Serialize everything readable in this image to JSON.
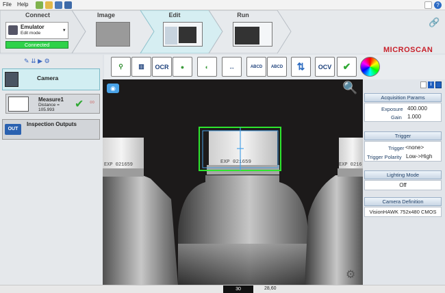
{
  "menubar": {
    "file": "File",
    "help": "Help"
  },
  "workflow": {
    "connect": {
      "label": "Connect",
      "device_name": "Emulator",
      "device_mode": "Edit mode",
      "status": "Connected"
    },
    "image": {
      "label": "Image"
    },
    "edit": {
      "label": "Edit"
    },
    "run": {
      "label": "Run"
    }
  },
  "brand": {
    "name": "MICROSCAN"
  },
  "toolbar": {
    "tools": [
      {
        "name": "locate-tool",
        "label": "⚲"
      },
      {
        "name": "barcode-tool",
        "label": "▥"
      },
      {
        "name": "ocr-tool",
        "label": "OCR"
      },
      {
        "name": "blob-tool",
        "label": "●"
      },
      {
        "name": "presence-tool",
        "label": "◐"
      },
      {
        "name": "measure-tool",
        "label": "↔"
      },
      {
        "name": "math-tool",
        "label": "ABCD"
      },
      {
        "name": "string-tool",
        "label": "ABCD"
      },
      {
        "name": "logic-tool",
        "label": "⇅"
      },
      {
        "name": "ocv-tool",
        "label": "OCV"
      },
      {
        "name": "verify-tool",
        "label": "✔"
      },
      {
        "name": "color-tool",
        "label": ""
      }
    ]
  },
  "left": {
    "camera_label": "Camera",
    "measure": {
      "name": "Measure1",
      "distance_label": "Distance =",
      "distance_value": "105.993"
    },
    "outputs_label": "Inspection Outputs",
    "outputs_icon": "OUT"
  },
  "image_view": {
    "cap_text": "EXP 021659",
    "cap_text_left": "EXP 021659",
    "cap_text_right": "EXP 0216"
  },
  "right": {
    "acq": {
      "title": "Acquisition Params",
      "exposure_label": "Exposure",
      "exposure_value": "400.000",
      "gain_label": "Gain",
      "gain_value": "1.000"
    },
    "trigger": {
      "title": "Trigger",
      "trigger_label": "Trigger",
      "trigger_value": "<none>",
      "polarity_label": "Trigger Polarity",
      "polarity_value": "Low->High"
    },
    "lighting": {
      "title": "Lighting Mode",
      "value": "Off"
    },
    "camdef": {
      "title": "Camera Definition",
      "value": "VisionHAWK 752x480 CMOS"
    }
  },
  "status": {
    "left_value": "30",
    "right_value": "28,60"
  },
  "colors": {
    "connected": "#2fd24a",
    "roi_green": "#2ee62e",
    "roi_blue": "#4aa3e8",
    "accent": "#1f3f66"
  }
}
